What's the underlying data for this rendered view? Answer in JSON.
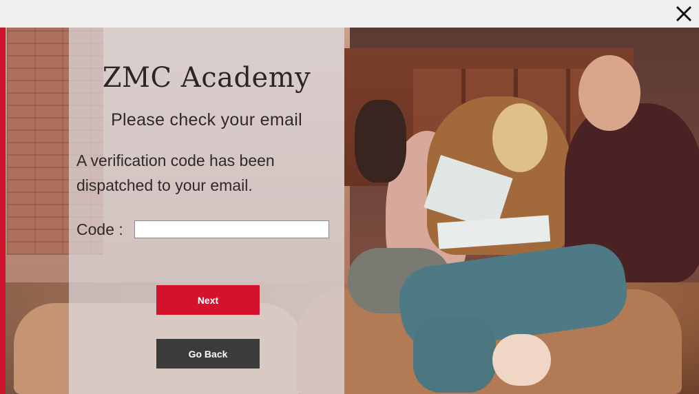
{
  "window": {
    "close_icon": "close-icon"
  },
  "form": {
    "app_title": "ZMC Academy",
    "heading": "Please check your email",
    "message": "A verification code has been dispatched to your email.",
    "code_label": "Code :",
    "code_value": "",
    "next_label": "Next",
    "back_label": "Go Back"
  },
  "colors": {
    "accent": "#d3122e",
    "secondary_button": "#3b3b3b",
    "titlebar": "#efefef"
  }
}
